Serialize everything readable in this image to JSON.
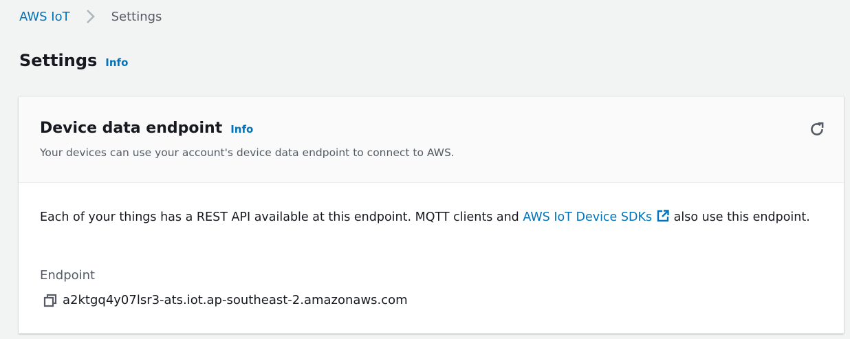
{
  "breadcrumb": {
    "items": [
      "AWS IoT",
      "Settings"
    ]
  },
  "page": {
    "title": "Settings",
    "info": "Info"
  },
  "card": {
    "title": "Device data endpoint",
    "info": "Info",
    "description": "Your devices can use your account's device data endpoint to connect to AWS.",
    "body_before": "Each of your things has a REST API available at this endpoint. MQTT clients and ",
    "body_link": "AWS IoT Device SDKs",
    "body_after": " also use this endpoint.",
    "endpoint_label": "Endpoint",
    "endpoint_value": "a2ktgq4y07lsr3-ats.iot.ap-southeast-2.amazonaws.com"
  },
  "icons": {
    "refresh": "refresh-icon",
    "external": "external-link-icon",
    "copy": "copy-icon",
    "separator": "chevron-right-icon"
  },
  "colors": {
    "link": "#0073bb",
    "background": "#f2f3f3"
  }
}
